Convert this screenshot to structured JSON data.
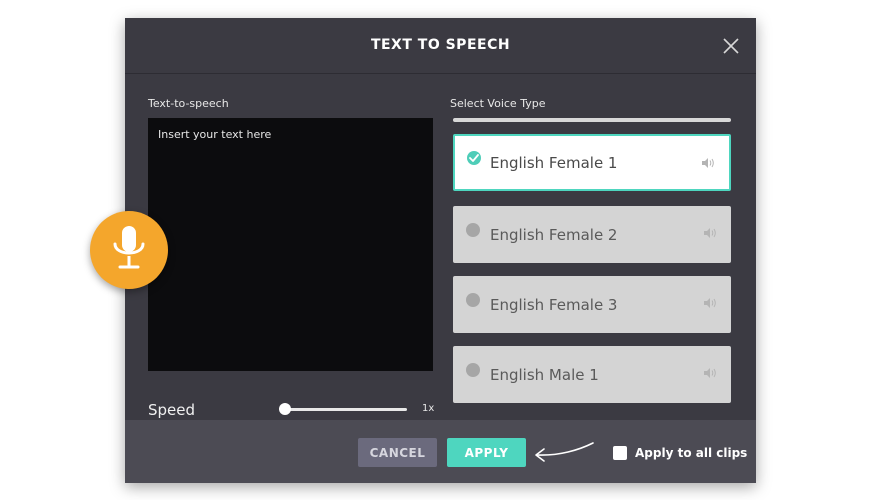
{
  "dialog": {
    "title": "TEXT TO SPEECH"
  },
  "text_panel": {
    "label": "Text-to-speech",
    "placeholder": "Insert your text here"
  },
  "speed": {
    "label": "Speed",
    "value_label": "1x",
    "slider_level": 0.0
  },
  "voice_panel": {
    "label": "Select Voice Type",
    "voices": [
      {
        "name": "English Female 1",
        "selected": true
      },
      {
        "name": "English Female 2",
        "selected": false
      },
      {
        "name": "English Female 3",
        "selected": false
      },
      {
        "name": "English Male 1",
        "selected": false
      }
    ]
  },
  "footer": {
    "cancel_label": "CANCEL",
    "apply_label": "APPLY",
    "apply_all_label": "Apply to all clips",
    "apply_all_checked": false
  },
  "colors": {
    "accent": "#4ed6bf",
    "mic_badge": "#f4a62c",
    "dialog_bg": "#3b3a42",
    "footer_bg": "#4c4b54"
  },
  "icons": {
    "close": "close-icon",
    "check": "check-icon",
    "speaker": "speaker-icon",
    "microphone": "microphone-icon",
    "arrow": "arrow-icon"
  }
}
